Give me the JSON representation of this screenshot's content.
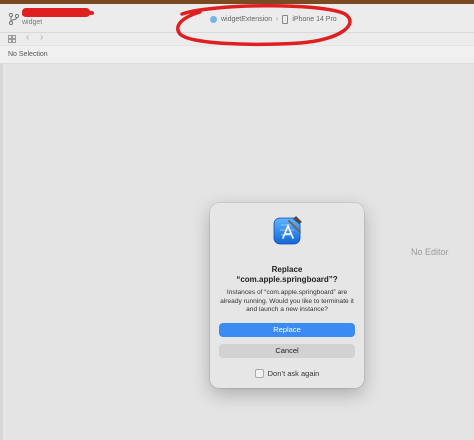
{
  "toolbar": {
    "project_subtitle": "widget",
    "scheme_target": "widgetExtension",
    "scheme_separator": "›",
    "scheme_device": "iPhone 14 Pro"
  },
  "jumpbar": {
    "back_glyph": "‹",
    "forward_glyph": "›"
  },
  "inspector": {
    "selection_label": "No Selection"
  },
  "editor": {
    "placeholder": "No Editor"
  },
  "dialog": {
    "title_line1": "Replace",
    "title_line2": "“com.apple.springboard”?",
    "message": "Instances of “com.apple.springboard” are already running. Would you like to terminate it and launch a new instance?",
    "primary_button": "Replace",
    "secondary_button": "Cancel",
    "checkbox_label": "Don’t ask again",
    "checkbox_checked": false,
    "app_icon": "xcode-icon",
    "accent_color": "#3b8bf5"
  },
  "annotations": {
    "color": "#e02020"
  }
}
